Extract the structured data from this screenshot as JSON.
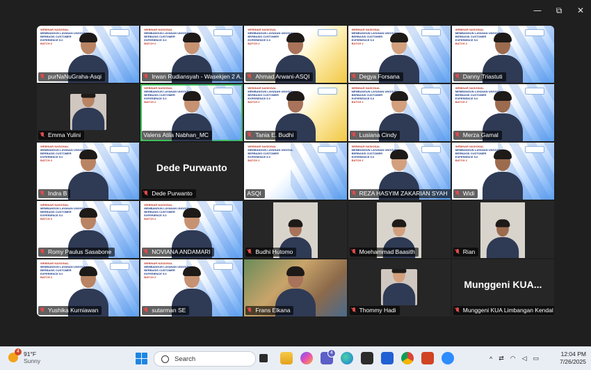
{
  "window": {
    "minimize_icon": "minimize-icon",
    "maximize_icon": "restore-icon",
    "close_icon": "close-icon",
    "minimize_glyph": "—",
    "restore_glyph": "⧉",
    "close_glyph": "✕"
  },
  "webinar_banner": {
    "line1": "WEBINAR NASIONAL",
    "line2": "MEMBANGUN LAYANAN UNGGUL",
    "line3": "BERBASIS CUSTOMER EXPERIENCE 5.0",
    "line4": "BATCH 2"
  },
  "participants": [
    {
      "name": "purNaNuGraha-Asqi",
      "bg": "webinar",
      "muted": true
    },
    {
      "name": "Irwan Rudiansyah - Wasekjen 2 A...",
      "bg": "webinar",
      "muted": true
    },
    {
      "name": "Ahmad Arwani-ASQI",
      "bg": "yellow",
      "muted": true
    },
    {
      "name": "Degya Forsana",
      "bg": "webinar",
      "muted": true
    },
    {
      "name": "Danny Triastuti",
      "bg": "webinar",
      "muted": true
    },
    {
      "name": "Emma Yulini",
      "bg": "dark",
      "muted": true
    },
    {
      "name": "Valens Atila Nabhan_MC",
      "bg": "webinar",
      "muted": false,
      "speaking": true
    },
    {
      "name": "Tania E. Budhi",
      "bg": "yellow",
      "muted": true
    },
    {
      "name": "Lusiana Cindy",
      "bg": "webinar",
      "muted": true
    },
    {
      "name": "Merza Gamal",
      "bg": "webinar",
      "muted": true
    },
    {
      "name": "Indra B",
      "bg": "webinar",
      "muted": true
    },
    {
      "name": "Dede Purwanto",
      "bg": "dark",
      "muted": true,
      "big_label": "Dede Purwanto"
    },
    {
      "name": "ASQI",
      "bg": "webinar",
      "muted": false
    },
    {
      "name": "REZA HASYIM ZAKARIAN SYAH",
      "bg": "webinar",
      "muted": true
    },
    {
      "name": "Widi",
      "bg": "webinar",
      "muted": true
    },
    {
      "name": "Romy Paulus Sasabone",
      "bg": "webinar",
      "muted": true
    },
    {
      "name": "NOVIANA ANDAMARI",
      "bg": "webinar",
      "muted": true
    },
    {
      "name": "Budhi Hutomo",
      "bg": "dark",
      "muted": true
    },
    {
      "name": "Moehammad Baasith",
      "bg": "dark",
      "muted": true
    },
    {
      "name": "Rian",
      "bg": "dark",
      "muted": true
    },
    {
      "name": "Yushika Kurniawan",
      "bg": "webinar",
      "muted": true
    },
    {
      "name": "sutarman SE",
      "bg": "webinar",
      "muted": true
    },
    {
      "name": "Frans Elkana",
      "bg": "photo",
      "muted": true
    },
    {
      "name": "Thommy Hadi",
      "bg": "dark",
      "muted": true
    },
    {
      "name": "Munggeni KUA Limbangan Kendal",
      "bg": "dark",
      "muted": true,
      "big_label": "Munggeni KUA..."
    }
  ],
  "taskbar": {
    "weather_badge": "4",
    "temperature": "91°F",
    "condition": "Sunny",
    "search_placeholder": "Search",
    "teams_badge": "4",
    "time": "12:04 PM",
    "date": "7/26/2025"
  }
}
